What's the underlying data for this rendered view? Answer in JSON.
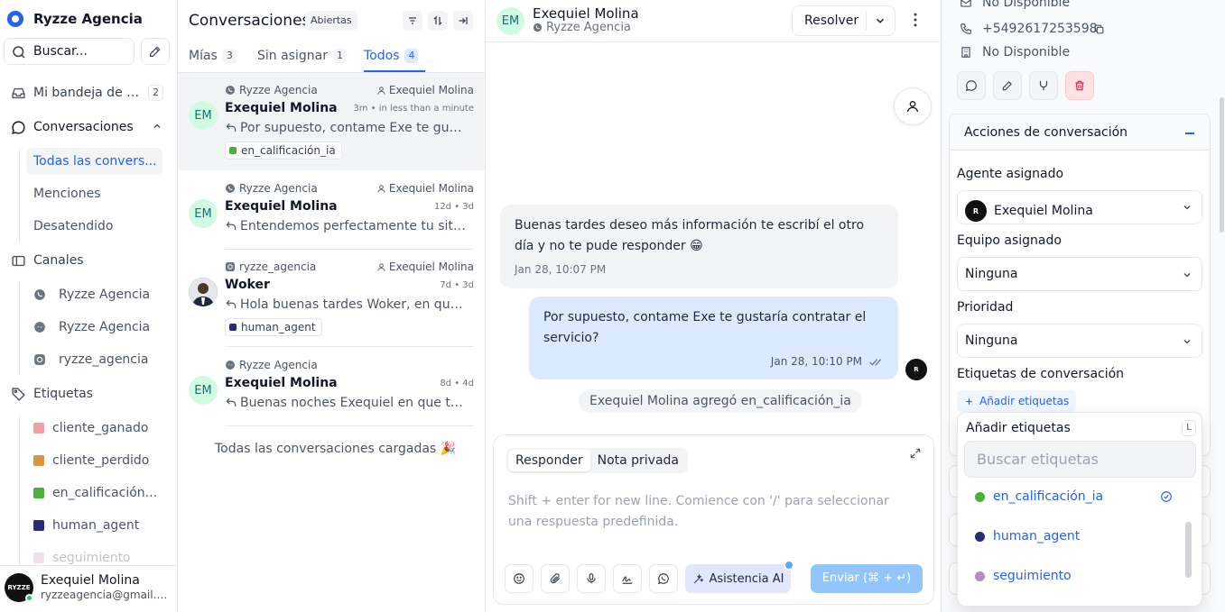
{
  "sidebar": {
    "brand": "Ryzze Agencia",
    "search_placeholder": "Buscar...",
    "inbox_label": "Mi bandeja de e...",
    "inbox_count": "2",
    "conversations_label": "Conversaciones",
    "conversation_items": [
      "Todas las convers...",
      "Menciones",
      "Desatendido"
    ],
    "channels_label": "Canales",
    "channels": [
      {
        "label": "Ryzze Agencia",
        "icon": "whatsapp-icon"
      },
      {
        "label": "Ryzze Agencia",
        "icon": "messenger-icon"
      },
      {
        "label": "ryzze_agencia",
        "icon": "instagram-icon"
      }
    ],
    "labels_label": "Etiquetas",
    "labels": [
      {
        "label": "cliente_ganado",
        "color": "#f0a0a0"
      },
      {
        "label": "cliente_perdido",
        "color": "#d9963f"
      },
      {
        "label": "en_calificación...",
        "color": "#4caf3a"
      },
      {
        "label": "human_agent",
        "color": "#2b2a7a"
      },
      {
        "label": "seguimiento",
        "color": "#d8a8c8"
      }
    ],
    "user": {
      "name": "Exequiel Molina",
      "email": "ryzzeagencia@gmail.c..."
    }
  },
  "conv_list": {
    "title": "Conversaciones",
    "status": "Abiertas",
    "tabs": [
      {
        "label": "Mías",
        "count": "3"
      },
      {
        "label": "Sin asignar",
        "count": "1"
      },
      {
        "label": "Todos",
        "count": "4"
      }
    ],
    "conversations": [
      {
        "inbox": "Ryzze Agencia",
        "inbox_icon": "whatsapp-icon",
        "assignee": "Exequiel Molina",
        "name": "Exequiel Molina",
        "time": "3m • in less than a minute",
        "message": "Por supuesto, contame Exe te gusta...",
        "avatar": "EM",
        "tag": "en_calificación_ia",
        "tag_color": "#4caf3a"
      },
      {
        "inbox": "Ryzze Agencia",
        "inbox_icon": "whatsapp-icon",
        "assignee": "Exequiel Molina",
        "name": "Exequiel Molina",
        "time": "12d • 3d",
        "message": "Entendemos perfectamente tu situa...",
        "avatar": "EM"
      },
      {
        "inbox": "ryzze_agencia",
        "inbox_icon": "instagram-icon",
        "assignee": "Exequiel Molina",
        "name": "Woker",
        "time": "7d • 3d",
        "message": "Hola buenas tardes Woker, en que p...",
        "avatar": "photo",
        "tag": "human_agent",
        "tag_color": "#2b2a7a"
      },
      {
        "inbox": "Ryzze Agencia",
        "inbox_icon": "messenger-icon",
        "assignee": "",
        "name": "Exequiel Molina",
        "time": "8d • 4d",
        "message": "Buenas noches Exequiel en que te p...",
        "avatar": "EM"
      }
    ],
    "all_loaded": "Todas las conversaciones cargadas 🎉"
  },
  "chat": {
    "avatar": "EM",
    "contact_name": "Exequiel Molina",
    "inbox": "Ryzze Agencia",
    "resolve_label": "Resolver",
    "incoming": {
      "text": "Buenas tardes deseo más información te escribí el otro día y no te pude responder 😁",
      "time": "Jan 28, 10:07 PM"
    },
    "outgoing": {
      "text": "Por supuesto, contame Exe te gustaría contratar el servicio?",
      "time": "Jan 28, 10:10 PM"
    },
    "activity": "Exequiel Molina agregó en_calificación_ia",
    "composer": {
      "tab_reply": "Responder",
      "tab_note": "Nota privada",
      "placeholder": "Shift + enter for new line. Comience con '/' para seleccionar una respuesta predefinida.",
      "ai_label": "Asistencia AI",
      "send_label": "Enviar (⌘ + ↵)"
    }
  },
  "contact_panel": {
    "email": "No Disponible",
    "phone": "+5492617253598",
    "company": "No Disponible",
    "actions_title": "Acciones de conversación",
    "agent_label": "Agente asignado",
    "agent_value": "Exequiel Molina",
    "team_label": "Equipo asignado",
    "team_value": "Ninguna",
    "priority_label": "Prioridad",
    "priority_value": "Ninguna",
    "labels_label": "Etiquetas de conversación",
    "add_labels": "Añadir etiquetas"
  },
  "label_dropdown": {
    "title": "Añadir etiquetas",
    "shortcut": "L",
    "search_placeholder": "Buscar etiquetas",
    "items": [
      {
        "label": "en_calificación_ia",
        "color": "#4caf3a",
        "selected": true
      },
      {
        "label": "human_agent",
        "color": "#2b2a7a",
        "selected": false
      },
      {
        "label": "seguimiento",
        "color": "#b48cc0",
        "selected": false
      }
    ]
  },
  "colors": {
    "accent": "#2563eb",
    "outgoing_bubble": "#dbeafe",
    "incoming_bubble": "#f3f4f6"
  }
}
